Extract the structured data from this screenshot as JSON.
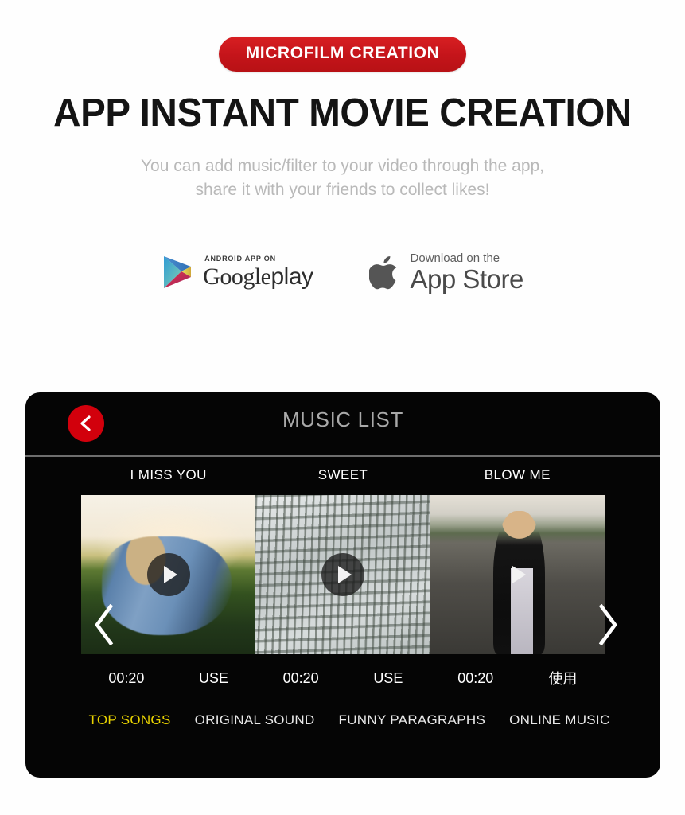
{
  "header": {
    "badge_label": "MICROFILM CREATION",
    "badge_color": "#c4141a",
    "headline": "APP INSTANT MOVIE CREATION",
    "subtitle_line1": "You can add music/filter to your video through the app,",
    "subtitle_line2": "share it with your friends to collect likes!"
  },
  "stores": {
    "google_play": {
      "icon": "google-play-triangle-icon",
      "top_label": "ANDROID APP ON",
      "brand": "Google",
      "suffix": "play"
    },
    "app_store": {
      "icon": "apple-logo-icon",
      "top_label": "Download on the",
      "brand": "App Store"
    }
  },
  "app": {
    "back_icon": "chevron-left-icon",
    "back_button_color": "#d2000c",
    "title": "MUSIC LIST",
    "prev_icon": "chevron-left-icon",
    "next_icon": "chevron-right-icon",
    "songs": [
      {
        "title": "I MISS YOU",
        "duration": "00:20",
        "action": "USE",
        "artwork": "woman-in-denim-field-sunset",
        "play_icon": "play-icon"
      },
      {
        "title": "SWEET",
        "duration": "00:20",
        "action": "USE",
        "artwork": "snowy-forest-aerial",
        "play_icon": "play-icon"
      },
      {
        "title": "BLOW ME",
        "duration": "00:20",
        "action": "使用",
        "artwork": "woman-leather-jacket-road",
        "play_icon": "play-icon"
      }
    ],
    "tabs": [
      {
        "label": "TOP SONGS",
        "active": true
      },
      {
        "label": "ORIGINAL SOUND",
        "active": false
      },
      {
        "label": "FUNNY PARAGRAPHS",
        "active": false
      },
      {
        "label": "ONLINE MUSIC",
        "active": false
      }
    ],
    "active_tab_color": "#e8d200"
  }
}
